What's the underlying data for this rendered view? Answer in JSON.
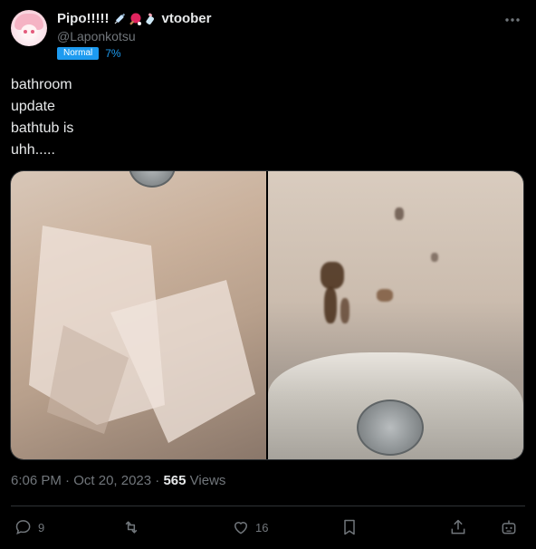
{
  "author": {
    "display_name": "Pipo!!!!!",
    "emojis": [
      "syringe-icon",
      "ping-pong-paddle-icon",
      "baby-bottle-icon"
    ],
    "name_suffix": "vtoober",
    "handle": "@Laponkotsu",
    "badge_label": "Normal",
    "badge_percent": "7%"
  },
  "tweet": {
    "lines": [
      "bathroom",
      "update",
      "bathtub is",
      "uhh....."
    ]
  },
  "meta": {
    "time": "6:06 PM",
    "separator": "·",
    "date": "Oct 20, 2023",
    "views_count": "565",
    "views_label": "Views"
  },
  "actions": {
    "replies": "9",
    "likes": "16"
  },
  "colors": {
    "background": "#000000",
    "text": "#e7e9ea",
    "muted": "#71767b",
    "accent": "#1d9bf0",
    "border": "#2f3336"
  }
}
